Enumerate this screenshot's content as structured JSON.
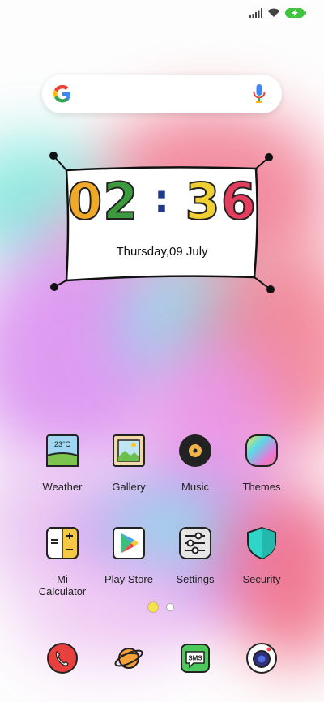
{
  "clock": {
    "h1": "0",
    "h2": "2",
    "colon": ":",
    "m1": "3",
    "m2": "6",
    "date": "Thursday,09 July"
  },
  "search": {
    "logo": "G"
  },
  "apps_row1": [
    {
      "label": "Weather",
      "icon": "weather-icon",
      "temp": "23°C"
    },
    {
      "label": "Gallery",
      "icon": "gallery-icon"
    },
    {
      "label": "Music",
      "icon": "music-icon"
    },
    {
      "label": "Themes",
      "icon": "themes-icon"
    }
  ],
  "apps_row2": [
    {
      "label": "Mi\nCalculator",
      "icon": "calculator-icon"
    },
    {
      "label": "Play Store",
      "icon": "play-store-icon"
    },
    {
      "label": "Settings",
      "icon": "settings-icon"
    },
    {
      "label": "Security",
      "icon": "security-icon"
    }
  ],
  "dock": [
    {
      "icon": "phone-icon"
    },
    {
      "icon": "browser-icon"
    },
    {
      "icon": "sms-icon",
      "text": "SMS"
    },
    {
      "icon": "camera-icon"
    }
  ],
  "colors": {
    "digit0": "#f0a828",
    "digit2": "#3c9a3c",
    "digit3": "#f0d030",
    "digit6": "#e23e5e"
  }
}
